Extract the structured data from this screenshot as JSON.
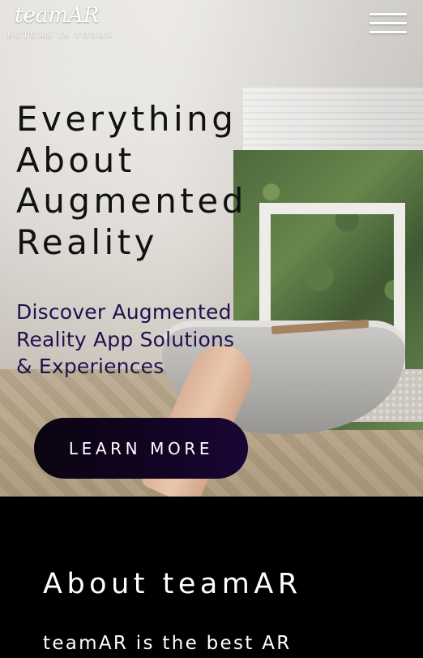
{
  "header": {
    "logo_name": "teamAR",
    "logo_tagline": "FUTURE IS YOURS",
    "menu_icon": "hamburger-menu-icon"
  },
  "hero": {
    "title_lines": [
      "Everything",
      "About",
      "Augmented",
      "Reality"
    ],
    "subtitle_lines": [
      "Discover Augmented",
      "Reality App Solutions",
      "& Experiences"
    ],
    "cta_label": "LEARN MORE",
    "background_image": "bathroom-interior-with-hand-pointing"
  },
  "about": {
    "heading": "About teamAR",
    "text_visible": "teamAR is the best AR"
  },
  "colors": {
    "hero_title": "#111111",
    "hero_subtitle": "#20104F",
    "cta_background": "#120424",
    "about_background": "#000000",
    "about_text": "#FFFFFF"
  }
}
